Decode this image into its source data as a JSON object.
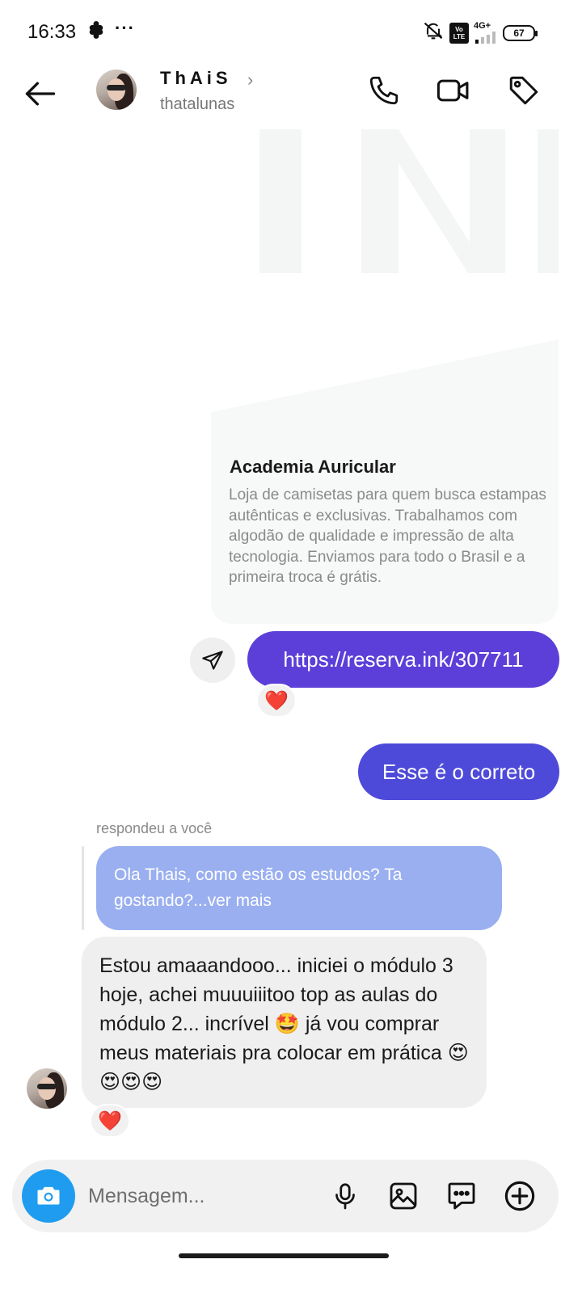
{
  "status_bar": {
    "time": "16:33",
    "network": "4G+",
    "battery": "67",
    "icons": [
      "clover-icon",
      "more-icon",
      "mute-icon",
      "volte-icon",
      "signal-icon",
      "battery-icon"
    ]
  },
  "header": {
    "contact_name": "ThAiS",
    "username": "thatalunas",
    "icons": [
      "back-arrow-icon",
      "phone-icon",
      "video-camera-icon",
      "tag-icon"
    ]
  },
  "link_preview": {
    "title": "Academia Auricular",
    "description": "Loja de camisetas para quem busca estampas autênticas e exclusivas. Trabalhamos com algodão de qualidade e impressão de alta tecnologia. Enviamos para todo o Brasil e a primeira troca é grátis."
  },
  "messages": {
    "link_message": "https://reserva.ink/307711",
    "correct_message": "Esse é o correto",
    "reply_label": "respondeu a você",
    "quoted_message": "Ola Thais, como estão os estudos? Ta gostando?...ver mais",
    "incoming_message": "Estou amaaandooo... iniciei o módulo 3 hoje, achei muuuiiitoo top as aulas do módulo 2... incrível 🤩 já vou comprar meus materiais pra colocar em prática 😍😍😍😍",
    "reaction": "❤️"
  },
  "composer": {
    "placeholder": "Mensagem...",
    "icons": [
      "camera-icon",
      "microphone-icon",
      "gallery-icon",
      "sticker-icon",
      "plus-icon"
    ]
  },
  "colors": {
    "link_bubble": "#5b3fd8",
    "correct_bubble": "#4e4ad9",
    "quoted_bubble": "#9aaff0",
    "incoming_bubble": "#efefef",
    "camera_button": "#1f9cf0"
  }
}
